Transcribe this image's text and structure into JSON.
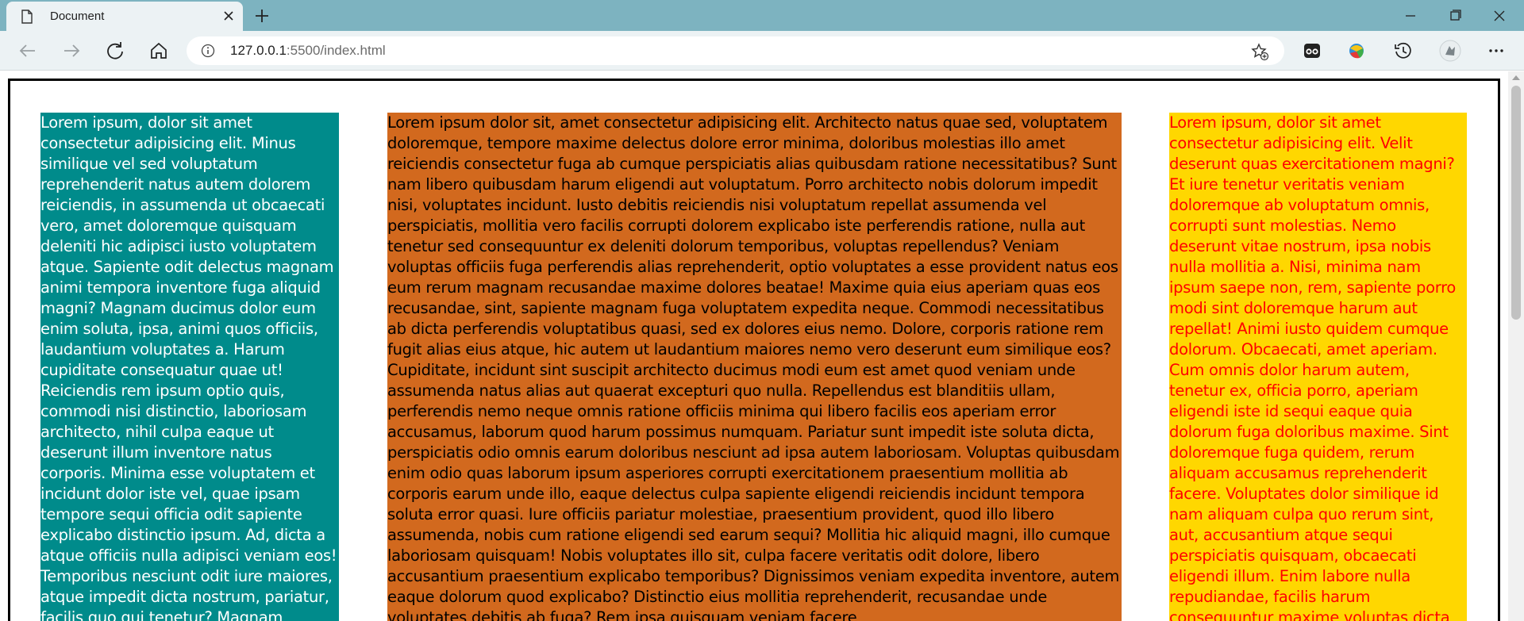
{
  "browser": {
    "tab_title": "Document",
    "url_host": "127.0.0.1",
    "url_rest": ":5500/index.html",
    "icons": [
      "page-icon",
      "close-icon",
      "plus-icon",
      "minimize-icon",
      "maximize-icon",
      "window-close-icon",
      "back-icon",
      "forward-icon",
      "refresh-icon",
      "home-icon",
      "info-icon",
      "favorite-add-icon",
      "extension-icon",
      "colorful-extension-icon",
      "history-icon",
      "profile-icon",
      "more-icon"
    ]
  },
  "page": {
    "left_text": "Lorem ipsum, dolor sit amet consectetur adipisicing elit. Minus similique vel sed voluptatum reprehenderit natus autem dolorem reiciendis, in assumenda ut obcaecati vero, amet doloremque quisquam deleniti hic adipisci iusto voluptatem atque. Sapiente odit delectus magnam animi tempora inventore fuga aliquid magni? Magnam ducimus dolor eum enim soluta, ipsa, animi quos officiis, laudantium voluptates a. Harum cupiditate consequatur quae ut! Reiciendis rem ipsum optio quis, commodi nisi distinctio, laboriosam architecto, nihil culpa eaque ut deserunt illum inventore natus corporis. Minima esse voluptatem et incidunt dolor iste vel, quae ipsam tempore sequi officia odit sapiente explicabo distinctio ipsum. Ad, dicta a atque officiis nulla adipisci veniam eos! Temporibus nesciunt odit iure maiores, atque impedit dicta nostrum, pariatur, facilis quo qui tenetur? Magnam",
    "middle_text": "Lorem ipsum dolor sit, amet consectetur adipisicing elit. Architecto natus quae sed, voluptatem doloremque, tempore maxime delectus dolore error minima, doloribus molestias illo amet reiciendis consectetur fuga ab cumque perspiciatis alias quibusdam ratione necessitatibus? Sunt nam libero quibusdam harum eligendi aut voluptatum. Porro architecto nobis dolorum impedit nisi, voluptates incidunt. Iusto debitis reiciendis nisi voluptatum repellat assumenda vel perspiciatis, mollitia vero facilis corrupti dolorem explicabo iste perferendis ratione, nulla aut tenetur sed consequuntur ex deleniti dolorum temporibus, voluptas repellendus? Veniam voluptas officiis fuga perferendis alias reprehenderit, optio voluptates a esse provident natus eos eum rerum magnam recusandae maxime dolores beatae! Maxime quia eius aperiam quas eos recusandae, sint, sapiente magnam fuga voluptatem expedita neque. Commodi necessitatibus ab dicta perferendis voluptatibus quasi, sed ex dolores eius nemo. Dolore, corporis ratione rem fugit alias eius atque, hic autem ut laudantium maiores nemo vero deserunt eum similique eos? Cupiditate, incidunt sint suscipit architecto ducimus modi eum est amet quod veniam unde assumenda natus alias aut quaerat excepturi quo nulla. Repellendus est blanditiis ullam, perferendis nemo neque omnis ratione officiis minima qui libero facilis eos aperiam error accusamus, laborum quod harum possimus numquam. Pariatur sunt impedit iste soluta dicta, perspiciatis odio omnis earum doloribus nesciunt ad ipsa autem laboriosam. Voluptas quibusdam enim odio quas laborum ipsum asperiores corrupti exercitationem praesentium mollitia ab corporis earum unde illo, eaque delectus culpa sapiente eligendi reiciendis incidunt tempora soluta error quasi. Iure officiis pariatur molestiae, praesentium provident, quod illo libero assumenda, nobis cum ratione eligendi sed earum sequi? Mollitia hic aliquid magni, illo cumque laboriosam quisquam! Nobis voluptates illo sit, culpa facere veritatis odit dolore, libero accusantium praesentium explicabo temporibus? Dignissimos veniam expedita inventore, autem eaque dolorum quod explicabo? Distinctio eius mollitia reprehenderit, recusandae unde voluptates debitis ab fuga? Rem ipsa quisquam veniam facere",
    "right_text": "Lorem ipsum, dolor sit amet consectetur adipisicing elit. Velit deserunt quas exercitationem magni? Et iure tenetur veritatis veniam doloremque ab voluptatum omnis, corrupti sunt molestias. Nemo deserunt vitae nostrum, ipsa nobis nulla mollitia a. Nisi, minima nam ipsum saepe non, rem, sapiente porro modi sint doloremque harum aut repellat! Animi iusto quidem cumque dolorum. Obcaecati, amet aperiam. Cum omnis dolor harum autem, tenetur ex, officia porro, aperiam eligendi iste id sequi eaque quia dolorum fuga doloribus maxime. Sint doloremque fuga quidem, rerum aliquam accusamus reprehenderit facere. Voluptates dolor similique id nam aliquam culpa quo rerum sint, aut, accusantium atque sequi perspiciatis quisquam, obcaecati eligendi illum. Enim labore nulla repudiandae, facilis harum consequuntur maxime voluptas dicta",
    "colors": {
      "left_bg": "#008b8b",
      "middle_bg": "#d2691e",
      "right_bg": "#ffd700",
      "right_text": "#ff0000"
    }
  }
}
